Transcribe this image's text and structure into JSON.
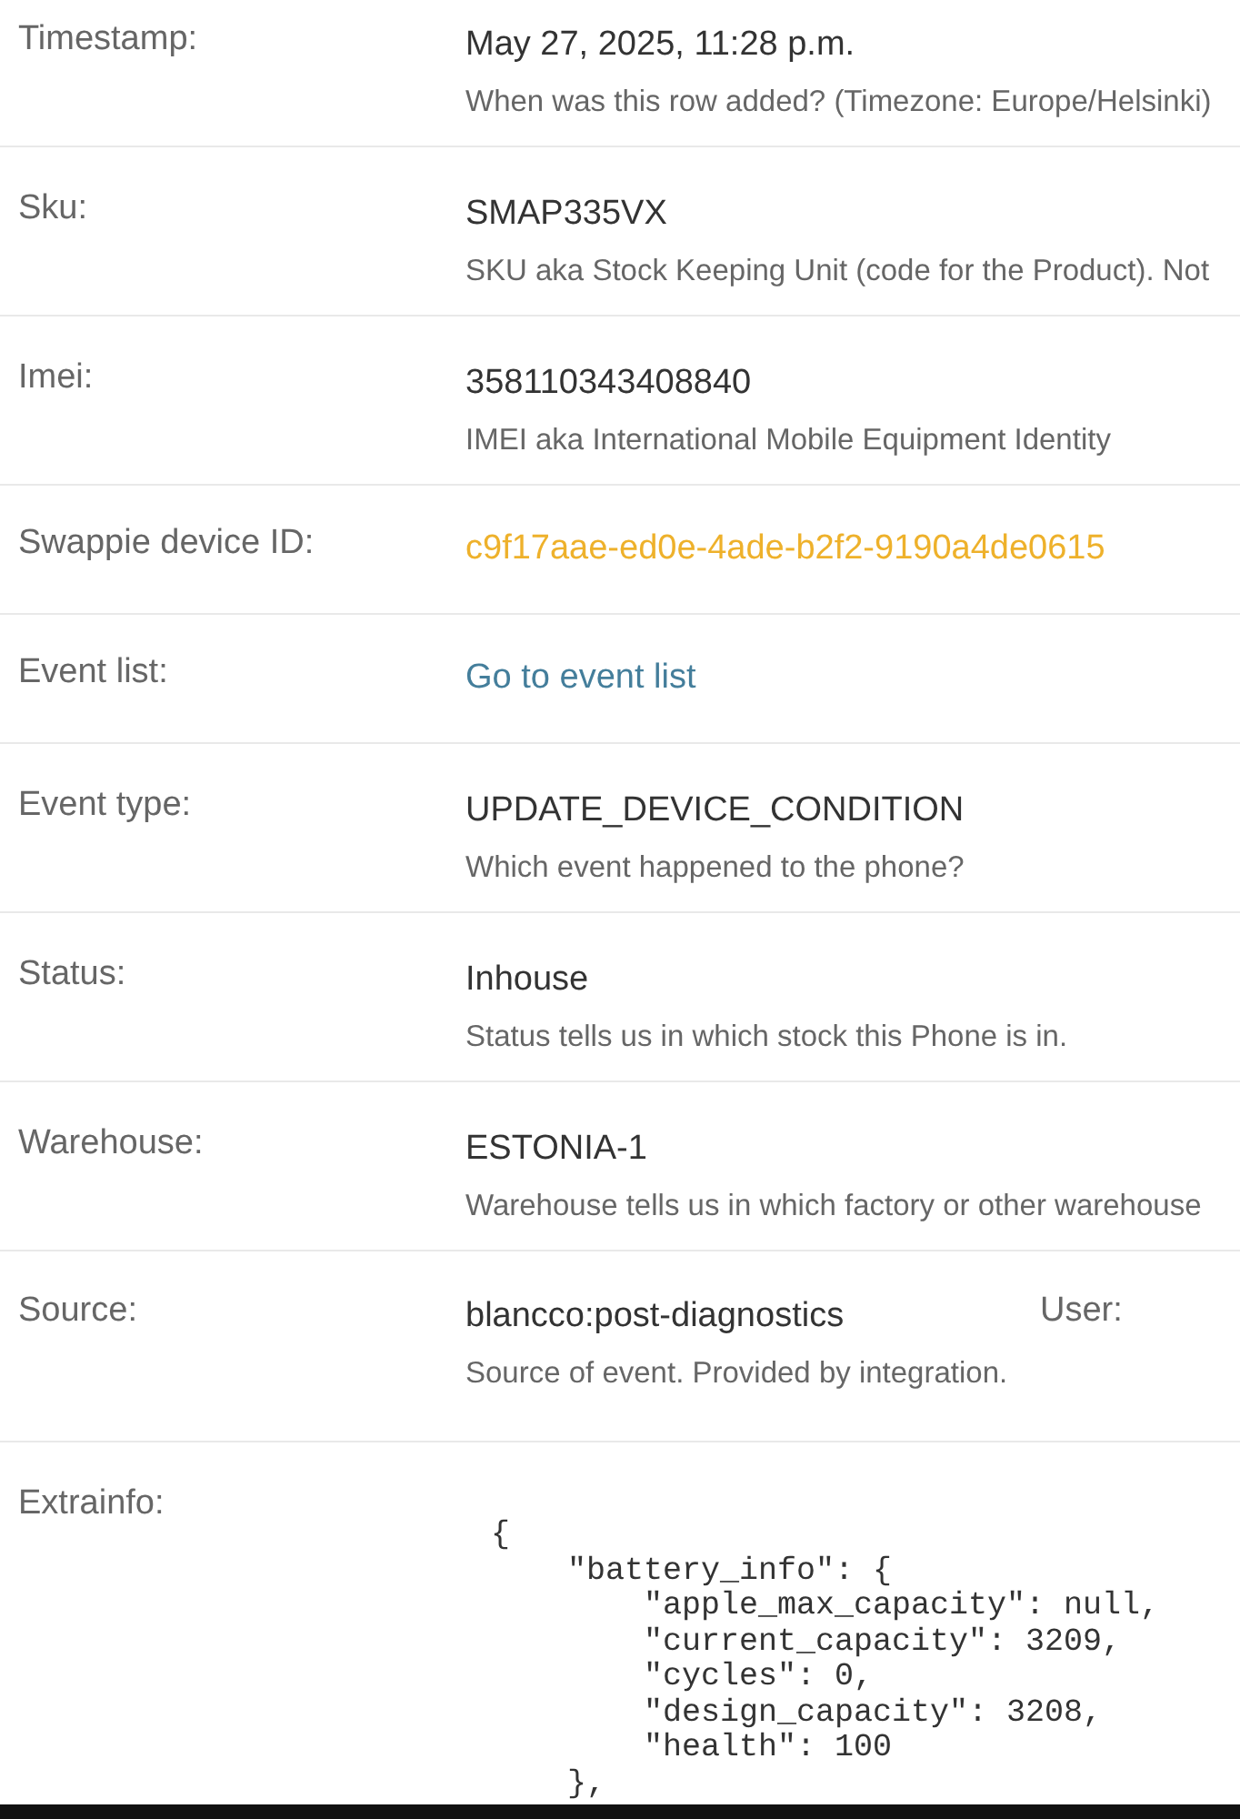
{
  "fields": [
    {
      "label": "Timestamp:",
      "kind": "text",
      "value": "May 27, 2025, 11:28 p.m.",
      "help": "When was this row added? (Timezone: Europe/Helsinki)"
    },
    {
      "label": "Sku:",
      "kind": "text",
      "value": "SMAP335VX",
      "help": "SKU aka Stock Keeping Unit (code for the Product). Not"
    },
    {
      "label": "Imei:",
      "kind": "text",
      "value": "358110343408840",
      "help": "IMEI aka International Mobile Equipment Identity"
    },
    {
      "label": "Swappie device ID:",
      "kind": "uuid",
      "value": "c9f17aae-ed0e-4ade-b2f2-9190a4de0615"
    },
    {
      "label": "Event list:",
      "kind": "link",
      "value": "Go to event list"
    },
    {
      "label": "Event type:",
      "kind": "text",
      "value": "UPDATE_DEVICE_CONDITION",
      "help": "Which event happened to the phone?"
    },
    {
      "label": "Status:",
      "kind": "text",
      "value": "Inhouse",
      "help": "Status tells us in which stock this Phone is in."
    },
    {
      "label": "Warehouse:",
      "kind": "text",
      "value": "ESTONIA-1",
      "help": "Warehouse tells us in which factory or other warehouse"
    },
    {
      "label": "Source:",
      "kind": "text",
      "value": "blancco:post-diagnostics",
      "help": "Source of event. Provided by integration.",
      "side_label": "User:"
    },
    {
      "label": "Extrainfo:",
      "kind": "code",
      "value": "{\n    \"battery_info\": {\n        \"apple_max_capacity\": null,\n        \"current_capacity\": 3209,\n        \"cycles\": 0,\n        \"design_capacity\": 3208,\n        \"health\": 100\n    },"
    }
  ]
}
